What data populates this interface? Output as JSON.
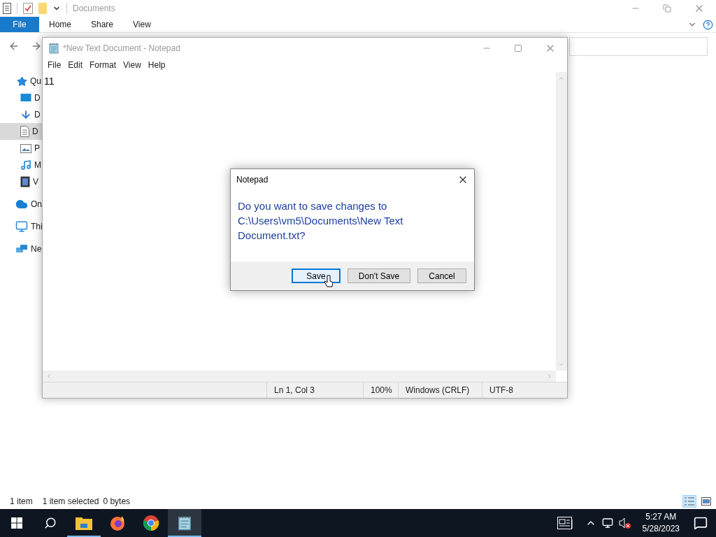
{
  "explorer": {
    "title": "Documents",
    "file_tab": "File",
    "ribbon_tabs": [
      "Home",
      "Share",
      "View"
    ],
    "nav": [
      {
        "label": "Qu",
        "kind": "star",
        "selected": false,
        "children": [
          {
            "label": "D",
            "kind": "desktop",
            "selected": false
          },
          {
            "label": "D",
            "kind": "download",
            "selected": false
          },
          {
            "label": "D",
            "kind": "document",
            "selected": true
          },
          {
            "label": "P",
            "kind": "pictures",
            "selected": false
          },
          {
            "label": "M",
            "kind": "music",
            "selected": false
          },
          {
            "label": "V",
            "kind": "videos",
            "selected": false
          }
        ]
      },
      {
        "label": "On",
        "kind": "cloud",
        "selected": false
      },
      {
        "label": "Thi",
        "kind": "pc",
        "selected": false
      },
      {
        "label": "Ne",
        "kind": "network",
        "selected": false
      }
    ],
    "item_count": "1 item",
    "selection": "1 item selected",
    "size": "0 bytes",
    "view_buttons": [
      {
        "kind": "details",
        "selected": true
      },
      {
        "kind": "large-icons",
        "selected": false
      }
    ]
  },
  "notepad": {
    "title": "*New Text Document - Notepad",
    "menu": [
      "File",
      "Edit",
      "Format",
      "View",
      "Help"
    ],
    "content": "11",
    "status": [
      "Ln 1, Col 3",
      "100%",
      "Windows (CRLF)",
      "UTF-8"
    ]
  },
  "dialog": {
    "title": "Notepad",
    "message": "Do you want to save changes to C:\\Users\\vm5\\Documents\\New Text Document.txt?",
    "buttons": [
      {
        "label": "Save",
        "default": true
      },
      {
        "label": "Don't Save",
        "default": false
      },
      {
        "label": "Cancel",
        "default": false
      }
    ]
  },
  "taskbar": {
    "apps": [
      {
        "kind": "folder",
        "running": true,
        "selected": false
      },
      {
        "kind": "firefox",
        "running": false,
        "selected": false
      },
      {
        "kind": "chrome",
        "running": false,
        "selected": false
      },
      {
        "kind": "notepad",
        "running": true,
        "selected": true
      }
    ],
    "time": "5:27 AM",
    "date": "5/28/2023",
    "volume_muted": true
  }
}
